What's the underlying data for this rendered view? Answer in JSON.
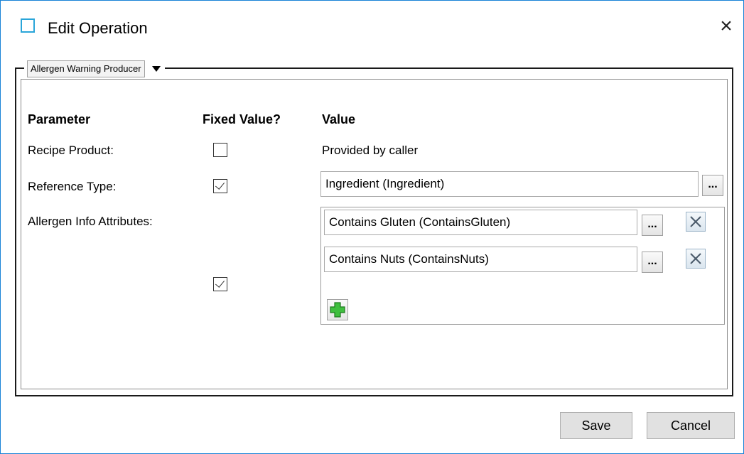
{
  "window": {
    "title": "Edit Operation",
    "close_glyph": "×"
  },
  "group": {
    "selector_label": "Allergen Warning Producer"
  },
  "headers": {
    "parameter": "Parameter",
    "fixed_value": "Fixed Value?",
    "value": "Value"
  },
  "params": {
    "recipe_product": {
      "label": "Recipe Product:",
      "fixed": false,
      "value": "Provided by caller"
    },
    "reference_type": {
      "label": "Reference Type:",
      "fixed": true,
      "value": "Ingredient (Ingredient)",
      "browse_label": "..."
    },
    "allergen_info": {
      "label": "Allergen Info Attributes:",
      "fixed": true,
      "items": [
        {
          "value": "Contains Gluten (ContainsGluten)",
          "browse_label": "..."
        },
        {
          "value": "Contains Nuts (ContainsNuts)",
          "browse_label": "..."
        }
      ]
    }
  },
  "buttons": {
    "save": "Save",
    "cancel": "Cancel"
  },
  "icons": {
    "window": "window-icon",
    "close": "close-icon",
    "dropdown": "triangle-down-icon",
    "remove": "remove-x-icon",
    "add": "green-plus-icon",
    "check": "checkmark-icon"
  },
  "colors": {
    "window_border": "#1883d7",
    "title_icon": "#2aa5d9",
    "add_green": "#2ea043",
    "button_face": "#e1e1e1"
  }
}
